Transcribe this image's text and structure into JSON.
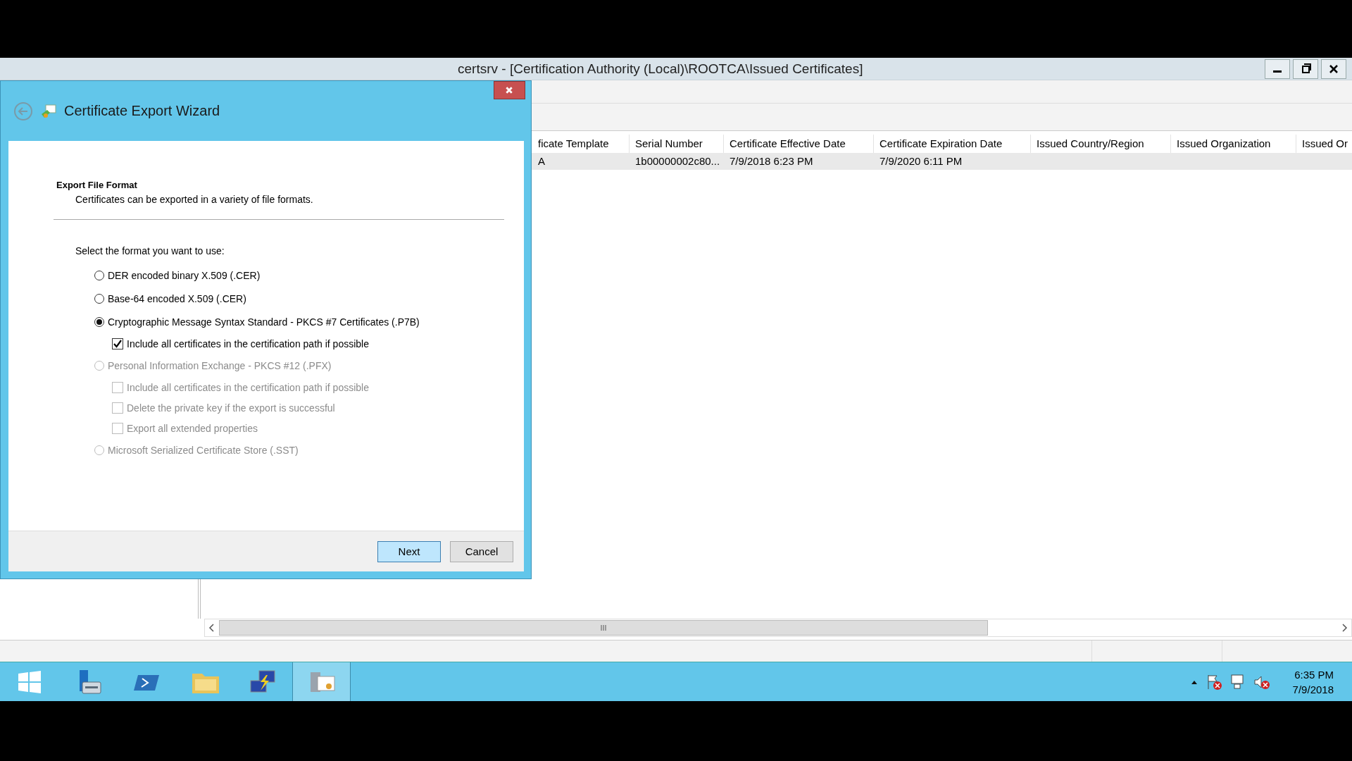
{
  "main_window": {
    "title": "certsrv - [Certification Authority (Local)\\ROOTCA\\Issued Certificates]",
    "columns": [
      "ficate Template",
      "Serial Number",
      "Certificate Effective Date",
      "Certificate Expiration Date",
      "Issued Country/Region",
      "Issued Organization",
      "Issued Or"
    ],
    "rows": [
      {
        "cells": [
          "A",
          "1b00000002c80...",
          "7/9/2018 6:23 PM",
          "7/9/2020 6:11 PM",
          "",
          "",
          ""
        ]
      }
    ]
  },
  "dialog": {
    "title": "Certificate Export Wizard",
    "heading": "Export File Format",
    "description": "Certificates can be exported in a variety of file formats.",
    "prompt": "Select the format you want to use:",
    "options": [
      {
        "label": "DER encoded binary X.509 (.CER)",
        "selected": false,
        "disabled": false
      },
      {
        "label": "Base-64 encoded X.509 (.CER)",
        "selected": false,
        "disabled": false
      },
      {
        "label": "Cryptographic Message Syntax Standard - PKCS #7 Certificates (.P7B)",
        "selected": true,
        "disabled": false,
        "children": [
          {
            "label": "Include all certificates in the certification path if possible",
            "checked": true,
            "disabled": false
          }
        ]
      },
      {
        "label": "Personal Information Exchange - PKCS #12 (.PFX)",
        "selected": false,
        "disabled": true,
        "children": [
          {
            "label": "Include all certificates in the certification path if possible",
            "checked": false,
            "disabled": true
          },
          {
            "label": "Delete the private key if the export is successful",
            "checked": false,
            "disabled": true
          },
          {
            "label": "Export all extended properties",
            "checked": false,
            "disabled": true
          }
        ]
      },
      {
        "label": "Microsoft Serialized Certificate Store (.SST)",
        "selected": false,
        "disabled": true
      }
    ],
    "buttons": [
      {
        "label": "Next",
        "default": true
      },
      {
        "label": "Cancel",
        "default": false
      }
    ]
  },
  "taskbar": {
    "apps": [
      {
        "kind": "server",
        "active": false
      },
      {
        "kind": "shell",
        "active": false
      },
      {
        "kind": "folder",
        "active": false
      },
      {
        "kind": "network",
        "active": false
      },
      {
        "kind": "certificate",
        "active": true
      }
    ],
    "time": "6:35 PM",
    "date": "7/9/2018"
  }
}
